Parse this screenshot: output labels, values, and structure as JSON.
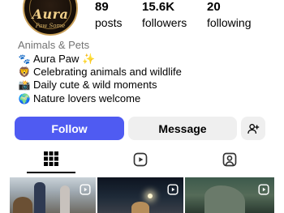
{
  "profile": {
    "avatar": {
      "logo_text": "Aura",
      "logo_sub": "Paw Some"
    },
    "stats": [
      {
        "value": "89",
        "label": "posts"
      },
      {
        "value": "15.6K",
        "label": "followers"
      },
      {
        "value": "20",
        "label": "following"
      }
    ],
    "category": "Animals & Pets",
    "bio": [
      {
        "emoji": "🐾",
        "text": "Aura Paw ✨"
      },
      {
        "emoji": "🦁",
        "text": "Celebrating animals and wildlife"
      },
      {
        "emoji": "📸",
        "text": "Daily cute & wild moments"
      },
      {
        "emoji": "🌍",
        "text": "Nature lovers welcome"
      }
    ]
  },
  "actions": {
    "follow_label": "Follow",
    "message_label": "Message",
    "add_user_icon": "person-add-icon"
  },
  "tabs": [
    {
      "icon": "grid-icon",
      "active": true
    },
    {
      "icon": "reels-icon",
      "active": false
    },
    {
      "icon": "tagged-icon",
      "active": false
    }
  ],
  "posts": [
    {
      "type": "reel",
      "badge_icon": "reel-play-icon"
    },
    {
      "type": "reel",
      "badge_icon": "reel-play-icon"
    },
    {
      "type": "reel",
      "badge_icon": "reel-play-icon"
    }
  ],
  "colors": {
    "follow_button": "#4f5bf2",
    "secondary_button": "#efefef",
    "muted_text": "#737373"
  }
}
